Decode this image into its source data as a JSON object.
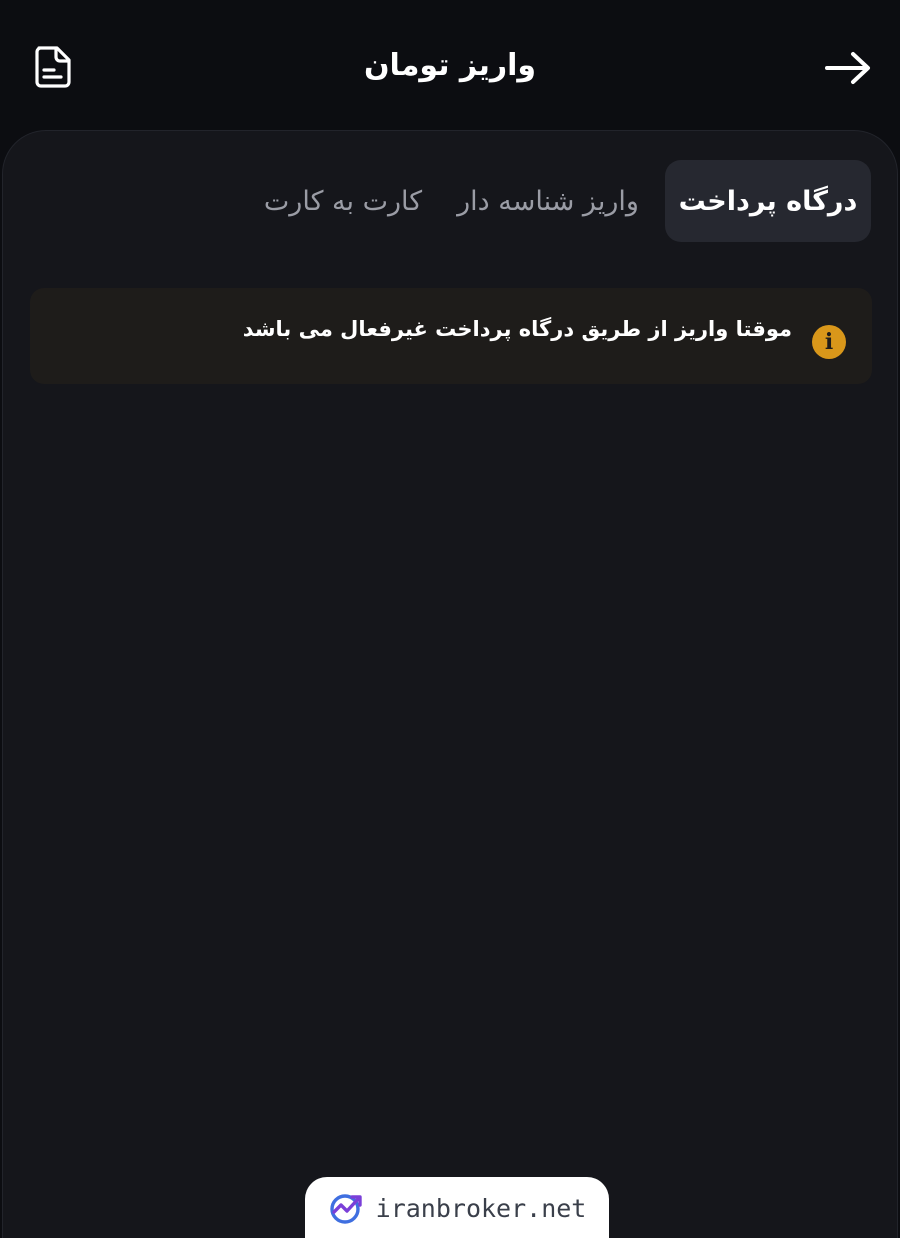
{
  "header": {
    "title": "واریز تومان",
    "back_icon": "arrow-right-icon",
    "history_icon": "document-icon"
  },
  "tabs": [
    {
      "label": "درگاه پرداخت",
      "active": true
    },
    {
      "label": "واریز شناسه دار",
      "active": false
    },
    {
      "label": "کارت به کارت",
      "active": false
    }
  ],
  "notice": {
    "text": "موقتا واریز از طریق درگاه پرداخت غیرفعال می باشد",
    "icon": "info-icon",
    "icon_glyph": "i"
  },
  "watermark": {
    "text": "iranbroker.net",
    "icon": "chart-logo-icon"
  },
  "colors": {
    "background": "#0c0d11",
    "card": "#15161b",
    "active_tab": "#262830",
    "notice_bg": "#1e1c1a",
    "warning": "#d9971a"
  }
}
